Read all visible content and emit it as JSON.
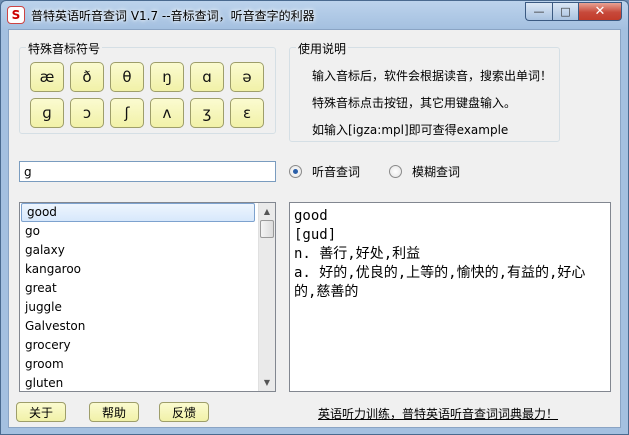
{
  "window": {
    "title": "普特英语听音查词 V1.7 --音标查词，听音查字的利器",
    "app_icon": "S",
    "minimize_glyph": "—",
    "maximize_glyph": "□",
    "close_glyph": "✕"
  },
  "symbols": {
    "title": "特殊音标符号",
    "items": [
      "æ",
      "ð",
      "θ",
      "ŋ",
      "ɑ",
      "ə",
      "ɡ",
      "ɔ",
      "ʃ",
      "ʌ",
      "ʒ",
      "ε"
    ]
  },
  "instructions": {
    "title": "使用说明",
    "lines": [
      "输入音标后，软件会根据读音，搜索出单词！",
      "特殊音标点击按钮，其它用键盘输入。",
      "如输入[igza:mpl]即可查得example"
    ]
  },
  "search": {
    "value": "g"
  },
  "modes": {
    "listen_label": "听音查词",
    "fuzzy_label": "模糊查词",
    "selected": "listen"
  },
  "word_list": {
    "items": [
      "good",
      "go",
      "galaxy",
      "kangaroo",
      "great",
      "juggle",
      "Galveston",
      "grocery",
      "groom",
      "gluten"
    ],
    "selected_index": 0
  },
  "meaning": {
    "word": "good",
    "phonetic": "[gud]",
    "definitions": [
      "n. 善行,好处,利益",
      "a. 好的,优良的,上等的,愉快的,有益的,好心的,慈善的"
    ]
  },
  "buttons": {
    "about": "关于",
    "help": "帮助",
    "feedback": "反馈"
  },
  "footer": {
    "link_text": "英语听力训练，普特英语听音查词词典最力！"
  }
}
